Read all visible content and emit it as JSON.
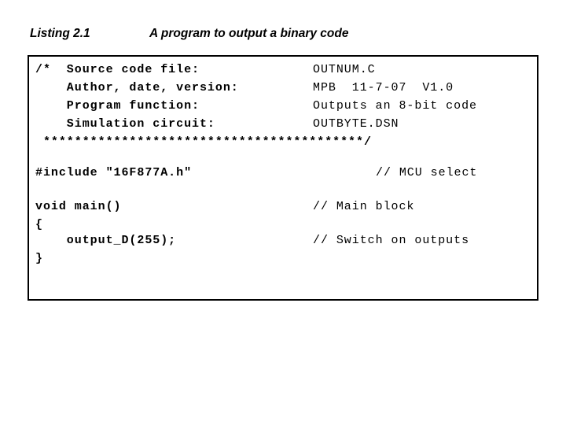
{
  "heading": {
    "title": "Listing 2.1",
    "subtitle": "A program to output a binary code"
  },
  "listing": {
    "lines": [
      {
        "code": "/*  Source code file:",
        "note": "OUTNUM.C"
      },
      {
        "code": "    Author, date, version:",
        "note": "MPB  11-7-07  V1.0"
      },
      {
        "code": "    Program function:",
        "note": "Outputs an 8-bit code"
      },
      {
        "code": "    Simulation circuit:",
        "note": "OUTBYTE.DSN"
      },
      {
        "stars": " *****************************************/"
      },
      {
        "code": "",
        "note": ""
      },
      {
        "code": "#include \"16F877A.h\"",
        "note_wide": "// MCU select"
      },
      {
        "code": "",
        "note": ""
      },
      {
        "code": "void main()",
        "note": "// Main block"
      },
      {
        "code": "{",
        "note": ""
      },
      {
        "code": "    output_D(255);",
        "note": "// Switch on outputs"
      },
      {
        "code": "}",
        "note": ""
      }
    ]
  },
  "colors": {
    "text": "#000000",
    "background": "#ffffff",
    "border": "#000000"
  }
}
